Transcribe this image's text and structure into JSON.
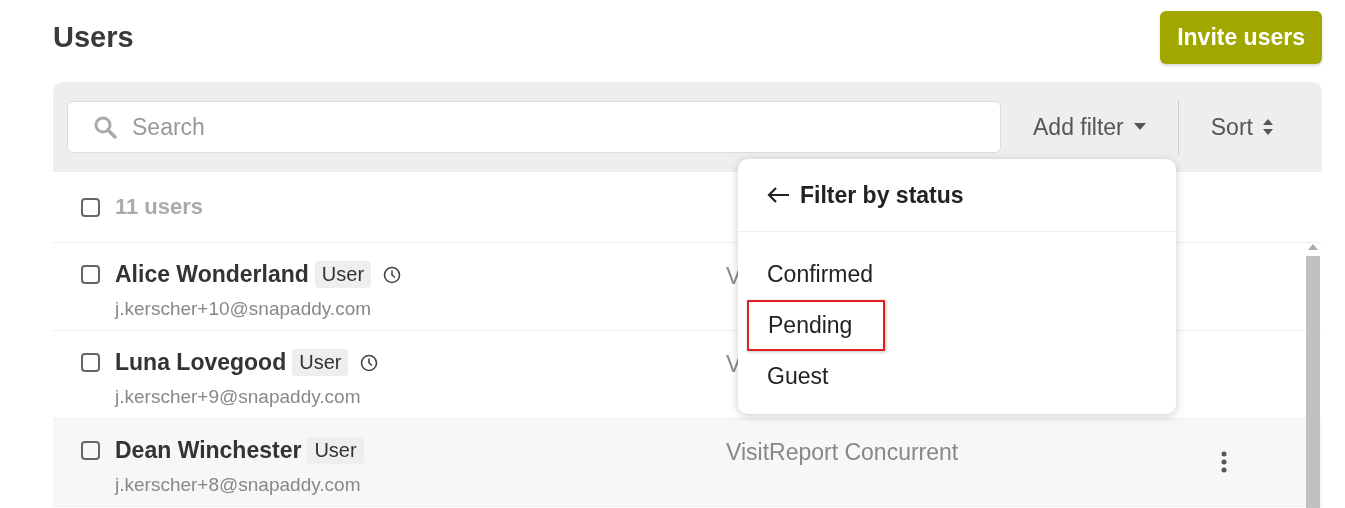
{
  "title": "Users",
  "invite_button": "Invite users",
  "search": {
    "placeholder": "Search"
  },
  "add_filter": "Add filter",
  "sort": "Sort",
  "list_header": {
    "count": "11 users",
    "checked": false
  },
  "users": [
    {
      "name": "Alice Wonderland",
      "role": "User",
      "pending": true,
      "email": "j.kerscher+10@snapaddy.com",
      "product": "V",
      "checked": false,
      "hovered": false
    },
    {
      "name": "Luna Lovegood",
      "role": "User",
      "pending": true,
      "email": "j.kerscher+9@snapaddy.com",
      "product": "V",
      "checked": false,
      "hovered": false
    },
    {
      "name": "Dean Winchester",
      "role": "User",
      "pending": false,
      "email": "j.kerscher+8@snapaddy.com",
      "product": "VisitReport Concurrent",
      "checked": false,
      "hovered": true
    }
  ],
  "filter_menu": {
    "title": "Filter by status",
    "items": [
      {
        "label": "Confirmed",
        "highlighted": false
      },
      {
        "label": "Pending",
        "highlighted": true
      },
      {
        "label": "Guest",
        "highlighted": false
      }
    ]
  }
}
